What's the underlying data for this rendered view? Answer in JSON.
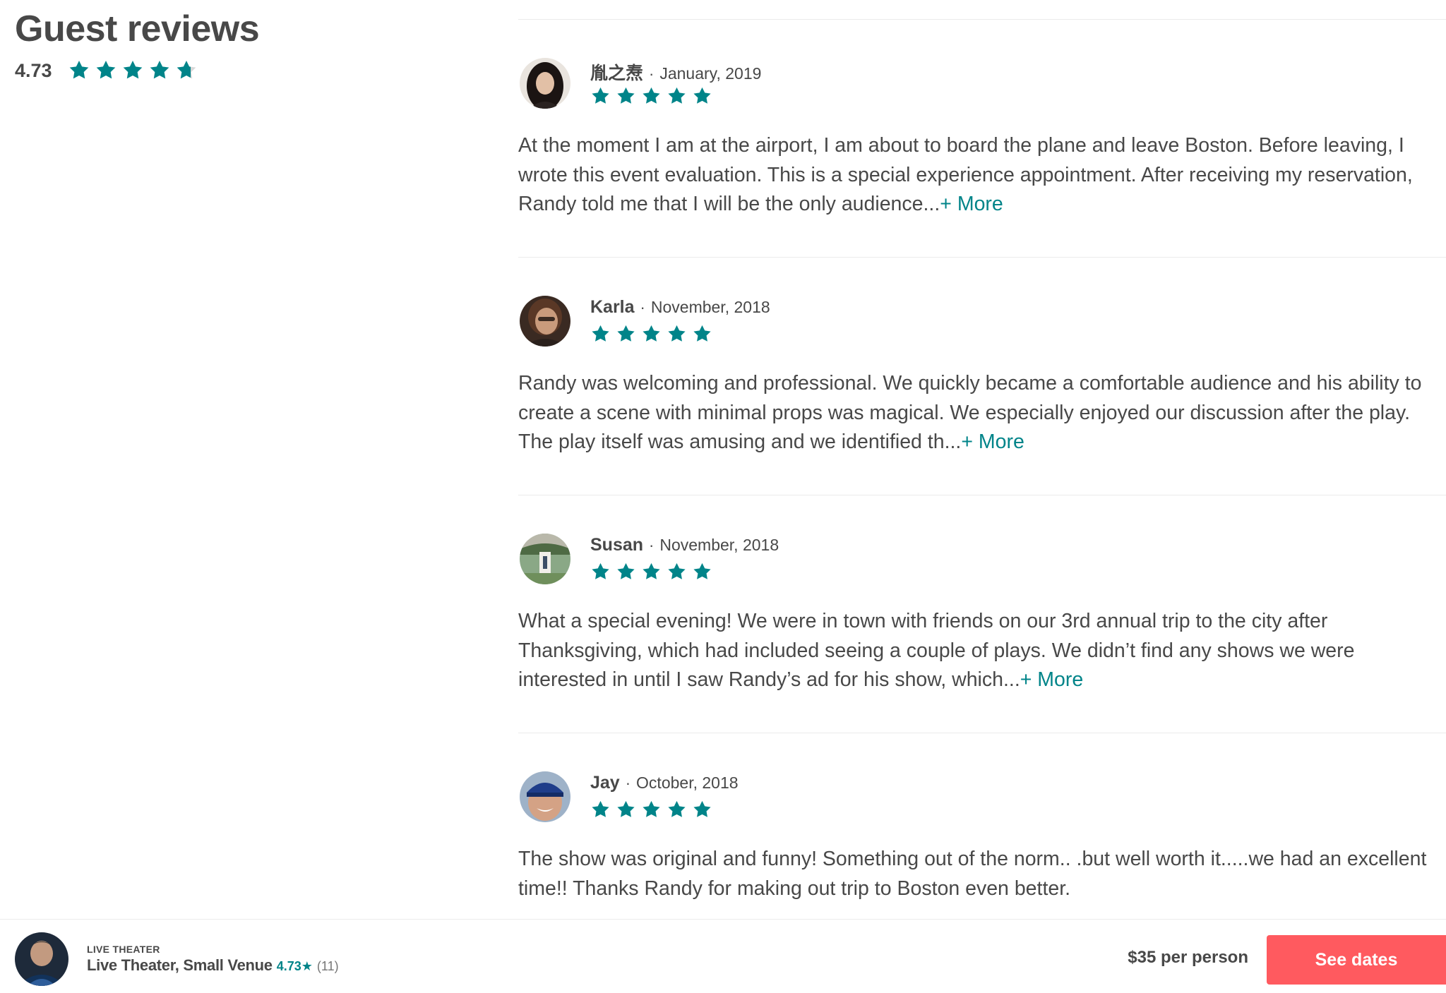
{
  "summary": {
    "title": "Guest reviews",
    "rating": "4.73",
    "rating_stars": 4.73
  },
  "colors": {
    "star": "#008489",
    "star_empty": "#d8d8d8",
    "more_link": "#008489",
    "cta": "#FF5A5F",
    "text": "#484848"
  },
  "reviews": [
    {
      "name": "胤之焘",
      "date": "January, 2019",
      "stars": 5,
      "text": "At the moment I am at the airport, I am about to board the plane and leave Boston. Before leaving, I wrote this event evaluation. This is a special experience appointment. After receiving my reservation, Randy told me that I will be the only audience...",
      "more": "+ More"
    },
    {
      "name": "Karla",
      "date": "November, 2018",
      "stars": 5,
      "text": "Randy was welcoming and professional. We quickly became a comfortable audience and his ability to create a scene with minimal props was magical. We especially enjoyed our discussion after the play. The play itself was amusing and we identified th...",
      "more": "+ More"
    },
    {
      "name": "Susan",
      "date": "November, 2018",
      "stars": 5,
      "text": "What a special evening! We were in town with friends on our 3rd annual trip to the city after Thanksgiving, which had included seeing a couple of plays. We didn’t find any shows we were interested in until I saw Randy’s ad for his show, which...",
      "more": "+ More"
    },
    {
      "name": "Jay",
      "date": "October, 2018",
      "stars": 5,
      "text": "The show was original and funny! Something out of the norm.. .but well worth it.....we had an excellent time!! Thanks Randy for making out trip to Boston even better.",
      "more": ""
    }
  ],
  "bottom_bar": {
    "category": "LIVE THEATER",
    "title": "Live Theater, Small Venue",
    "rating": "4.73★",
    "count": "(11)",
    "price": "$35 per person",
    "cta_label": "See dates"
  }
}
